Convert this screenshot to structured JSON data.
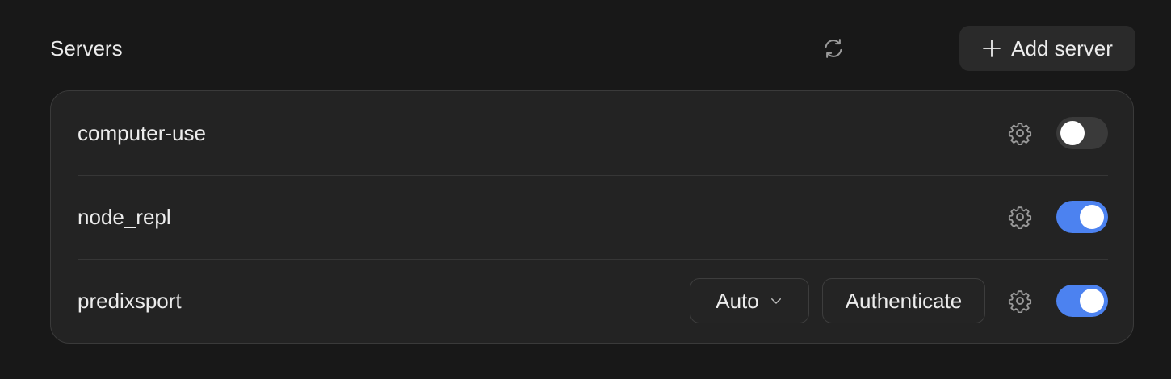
{
  "header": {
    "title": "Servers",
    "refresh_icon": "refresh-icon",
    "add_label": "Add server",
    "add_icon": "plus-icon"
  },
  "servers": [
    {
      "name": "computer-use",
      "enabled": false,
      "settings_icon": "gear-icon"
    },
    {
      "name": "node_repl",
      "enabled": true,
      "settings_icon": "gear-icon"
    },
    {
      "name": "predixsport",
      "enabled": true,
      "settings_icon": "gear-icon",
      "mode": {
        "selected": "Auto",
        "icon": "chevron-down-icon"
      },
      "auth_label": "Authenticate"
    }
  ],
  "colors": {
    "background": "#181818",
    "card": "#232323",
    "toggle_on": "#4c82f0",
    "toggle_off": "#3a3a3a",
    "text": "#ececec"
  }
}
